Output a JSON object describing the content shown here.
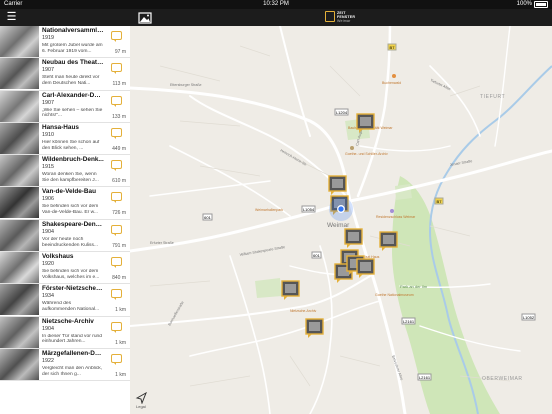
{
  "status": {
    "carrier": "Carrier",
    "time": "10:32 PM",
    "battery": "100%"
  },
  "topbar": {
    "logo_line1": "ZEIT",
    "logo_line2": "FENSTER",
    "logo_line3": "Weimar"
  },
  "items": [
    {
      "title": "Nationalversammlung",
      "year": "1919",
      "desc": "Mit großem Jubel wurde am 6. Februar 1919 vom...",
      "dist": "97 m",
      "c1": "#6f6f6f",
      "c2": "#cfcfcf"
    },
    {
      "title": "Neubau des Theaters",
      "year": "1907",
      "desc": "Steht man heute direkt vor dem Deutschen Nati...",
      "dist": "113 m",
      "c1": "#555",
      "c2": "#bdbdbd"
    },
    {
      "title": "Carl-Alexander-Den...",
      "year": "1907",
      "desc": "„Wie Sie sehen – sehen Sie nichts!\"...",
      "dist": "133 m",
      "c1": "#777",
      "c2": "#d6d6d6"
    },
    {
      "title": "Hansa-Haus",
      "year": "1910",
      "desc": "Hier können Sie schon auf den Blick sehen, ...",
      "dist": "449 m",
      "c1": "#4d4d4d",
      "c2": "#aaa"
    },
    {
      "title": "Wildenbruch-Denk...",
      "year": "1915",
      "desc": "Woran denken Sie, wenn Sie den kampfbereiten J...",
      "dist": "610 m",
      "c1": "#666",
      "c2": "#c8c8c8"
    },
    {
      "title": "Van-de-Velde-Bau",
      "year": "1906",
      "desc": "Sie befinden sich vor dem Van-de-Velde-Bau. Er w...",
      "dist": "726 m",
      "c1": "#333",
      "c2": "#9a9a9a"
    },
    {
      "title": "Shakespeare-Denk...",
      "year": "1904",
      "desc": "Vor der heute noch beeindruckenden Kuliss...",
      "dist": "791 m",
      "c1": "#5a5a5a",
      "c2": "#b5b5b5"
    },
    {
      "title": "Volkshaus",
      "year": "1920",
      "desc": "Sie befinden sich vor dem Volkshaus, welches im e...",
      "dist": "840 m",
      "c1": "#707070",
      "c2": "#dadada"
    },
    {
      "title": "Förster-Nietzsche &...",
      "year": "1934",
      "desc": "Während des aufkommenden National...",
      "dist": "1 km",
      "c1": "#444",
      "c2": "#a5a5a5"
    },
    {
      "title": "Nietzsche-Archiv",
      "year": "1904",
      "desc": "In dieser Tür stand vor rund einhundert Jahren...",
      "dist": "1 km",
      "c1": "#606060",
      "c2": "#c2c2c2"
    },
    {
      "title": "Märzgefallenen-Den...",
      "year": "1922",
      "desc": "Vergleicht man den Anblick, der sich Ihnen g...",
      "dist": "1 km",
      "c1": "#505050",
      "c2": "#bbb"
    }
  ],
  "map": {
    "city": "Weimar",
    "district_tiefurt": "TIEFURT",
    "district_oberweimar": "OBERWEIMAR",
    "park": "Park an der Ilm",
    "roads": [
      "B7",
      "B85",
      "L1054",
      "L2161",
      "L1052",
      "L1204",
      "601"
    ],
    "streets": [
      "Ettersburger Straße",
      "Jenaer Straße",
      "Tiefurter Allee",
      "Heinrich-Heine-Str.",
      "Erfurter Straße",
      "Belvederer Allee",
      "Carl-August-Allee",
      "Steubenstraße",
      "William-Shakespeare-Straße",
      "Bonhoefferstraße"
    ],
    "pois": [
      "Bauhaus-Universität Weimar",
      "Goethe- und Schiller-Archiv",
      "Weimarhallenpark",
      "Residenzschloss Weimar",
      "Nietzsche-Archiv",
      "Goethe Nationalmuseum",
      "Gedenkstätte Weimar",
      "Liszt Haus",
      "Buchenwald"
    ],
    "legal": "Legal",
    "accent": "#e4b03a",
    "user_dot": "#3478f6"
  }
}
